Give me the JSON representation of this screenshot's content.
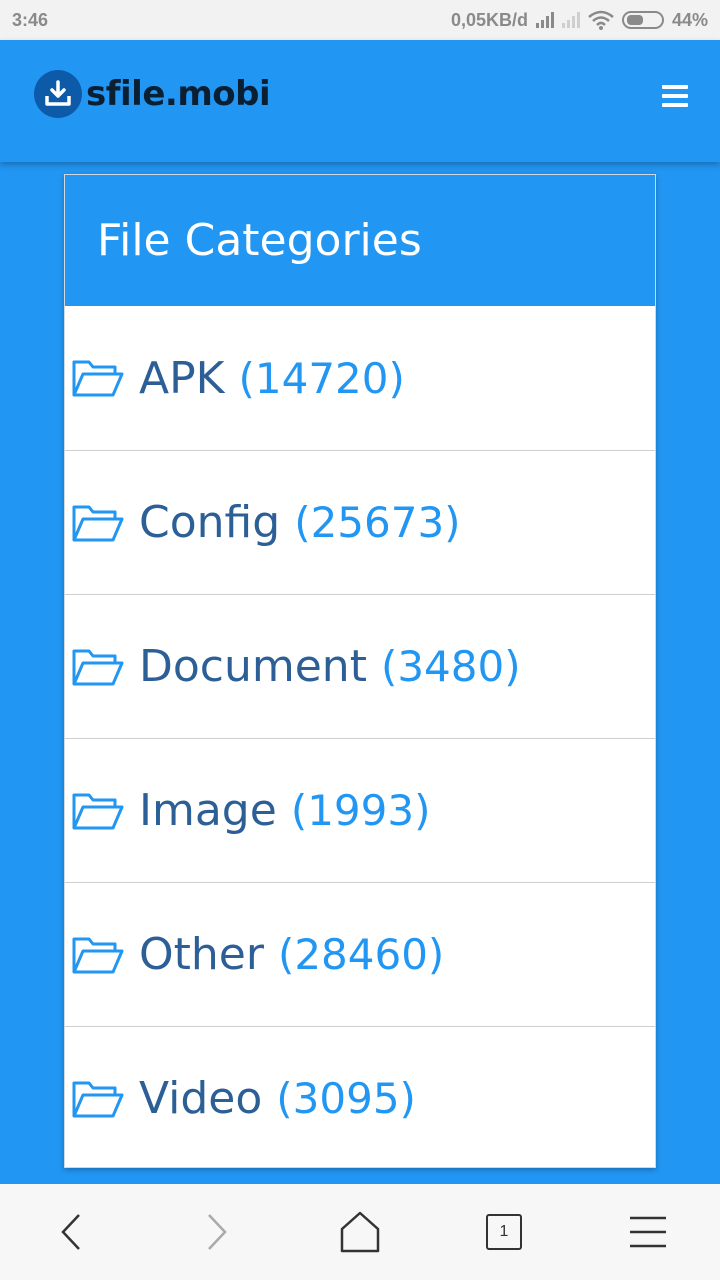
{
  "status_bar": {
    "time": "3:46",
    "network_speed": "0,05KB/d",
    "battery": "44%"
  },
  "header": {
    "logo_text": "sfile.mobi",
    "logo_icon": "download-icon",
    "menu_icon": "hamburger-menu-icon"
  },
  "card": {
    "title": "File Categories",
    "categories": [
      {
        "name": "APK",
        "count": "(14720)"
      },
      {
        "name": "Config",
        "count": "(25673)"
      },
      {
        "name": "Document",
        "count": "(3480)"
      },
      {
        "name": "Image",
        "count": "(1993)"
      },
      {
        "name": "Other",
        "count": "(28460)"
      },
      {
        "name": "Video",
        "count": "(3095)"
      }
    ],
    "item_icon": "folder-open-icon"
  },
  "nav": {
    "tab_count": "1"
  },
  "colors": {
    "accent": "#2196F3",
    "category_name": "#2d5f97"
  }
}
